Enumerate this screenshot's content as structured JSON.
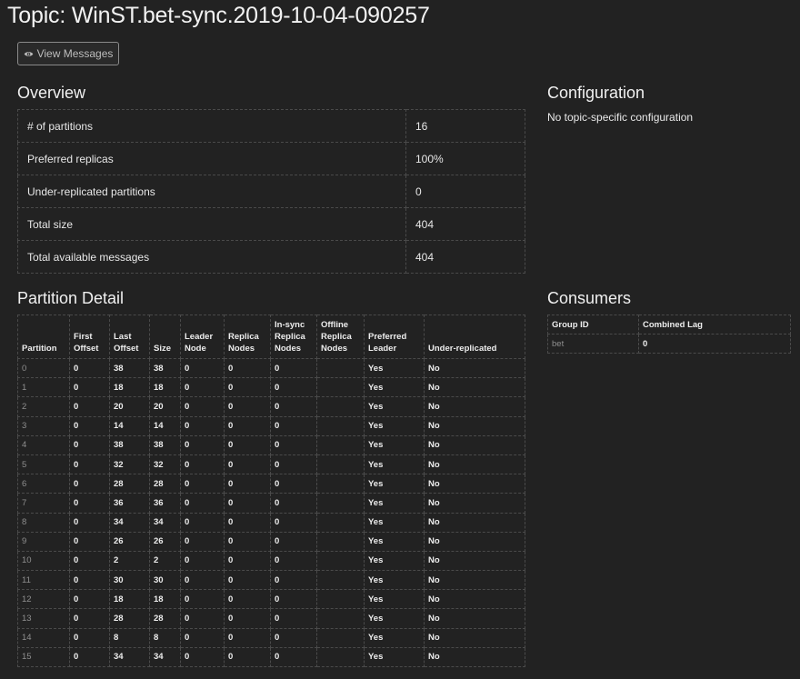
{
  "page": {
    "title": "Topic: WinST.bet-sync.2019-10-04-090257"
  },
  "toolbar": {
    "view_messages_label": "View Messages",
    "view_messages_icon": "eye-icon"
  },
  "overview": {
    "heading": "Overview",
    "rows": [
      {
        "label": "# of partitions",
        "value": "16"
      },
      {
        "label": "Preferred replicas",
        "value": "100%"
      },
      {
        "label": "Under-replicated partitions",
        "value": "0"
      },
      {
        "label": "Total size",
        "value": "404"
      },
      {
        "label": "Total available messages",
        "value": "404"
      }
    ]
  },
  "configuration": {
    "heading": "Configuration",
    "text": "No topic-specific configuration"
  },
  "partition_detail": {
    "heading": "Partition Detail",
    "columns": [
      [
        "Partition"
      ],
      [
        "First",
        "Offset"
      ],
      [
        "Last",
        "Offset"
      ],
      [
        "Size"
      ],
      [
        "Leader",
        "Node"
      ],
      [
        "Replica",
        "Nodes"
      ],
      [
        "In-sync",
        "Replica",
        "Nodes"
      ],
      [
        "Offline",
        "Replica",
        "Nodes"
      ],
      [
        "Preferred",
        "Leader"
      ],
      [
        "Under-replicated"
      ]
    ],
    "rows": [
      [
        "0",
        "0",
        "38",
        "38",
        "0",
        "0",
        "0",
        "",
        "Yes",
        "No"
      ],
      [
        "1",
        "0",
        "18",
        "18",
        "0",
        "0",
        "0",
        "",
        "Yes",
        "No"
      ],
      [
        "2",
        "0",
        "20",
        "20",
        "0",
        "0",
        "0",
        "",
        "Yes",
        "No"
      ],
      [
        "3",
        "0",
        "14",
        "14",
        "0",
        "0",
        "0",
        "",
        "Yes",
        "No"
      ],
      [
        "4",
        "0",
        "38",
        "38",
        "0",
        "0",
        "0",
        "",
        "Yes",
        "No"
      ],
      [
        "5",
        "0",
        "32",
        "32",
        "0",
        "0",
        "0",
        "",
        "Yes",
        "No"
      ],
      [
        "6",
        "0",
        "28",
        "28",
        "0",
        "0",
        "0",
        "",
        "Yes",
        "No"
      ],
      [
        "7",
        "0",
        "36",
        "36",
        "0",
        "0",
        "0",
        "",
        "Yes",
        "No"
      ],
      [
        "8",
        "0",
        "34",
        "34",
        "0",
        "0",
        "0",
        "",
        "Yes",
        "No"
      ],
      [
        "9",
        "0",
        "26",
        "26",
        "0",
        "0",
        "0",
        "",
        "Yes",
        "No"
      ],
      [
        "10",
        "0",
        "2",
        "2",
        "0",
        "0",
        "0",
        "",
        "Yes",
        "No"
      ],
      [
        "11",
        "0",
        "30",
        "30",
        "0",
        "0",
        "0",
        "",
        "Yes",
        "No"
      ],
      [
        "12",
        "0",
        "18",
        "18",
        "0",
        "0",
        "0",
        "",
        "Yes",
        "No"
      ],
      [
        "13",
        "0",
        "28",
        "28",
        "0",
        "0",
        "0",
        "",
        "Yes",
        "No"
      ],
      [
        "14",
        "0",
        "8",
        "8",
        "0",
        "0",
        "0",
        "",
        "Yes",
        "No"
      ],
      [
        "15",
        "0",
        "34",
        "34",
        "0",
        "0",
        "0",
        "",
        "Yes",
        "No"
      ]
    ]
  },
  "consumers": {
    "heading": "Consumers",
    "columns": [
      "Group ID",
      "Combined Lag"
    ],
    "rows": [
      [
        "bet",
        "0"
      ]
    ]
  }
}
